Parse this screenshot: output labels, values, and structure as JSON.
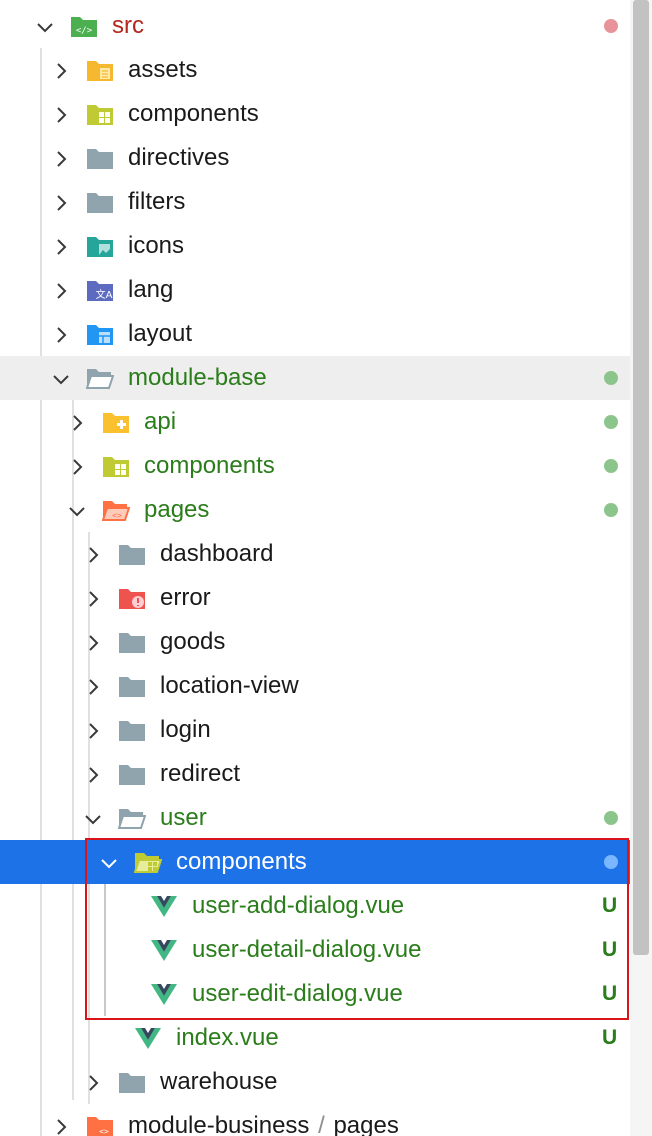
{
  "colors": {
    "modified_dot": "#8cc58c",
    "conflict_dot": "#e8929a",
    "selected_dot": "#7ab7ff",
    "untracked_text": "#2a7d1a",
    "selection_bg": "#1d72e8",
    "highlight_border": "#d9151a"
  },
  "tree": {
    "src": {
      "label": "src",
      "icon": "src-folder-icon",
      "state": "expanded"
    },
    "assets": {
      "label": "assets",
      "icon": "assets-folder-icon",
      "state": "collapsed"
    },
    "components": {
      "label": "components",
      "icon": "components-folder-icon",
      "state": "collapsed"
    },
    "directives": {
      "label": "directives",
      "icon": "folder-icon",
      "state": "collapsed"
    },
    "filters": {
      "label": "filters",
      "icon": "folder-icon",
      "state": "collapsed"
    },
    "icons": {
      "label": "icons",
      "icon": "images-folder-icon",
      "state": "collapsed"
    },
    "lang": {
      "label": "lang",
      "icon": "i18n-folder-icon",
      "state": "collapsed"
    },
    "layout": {
      "label": "layout",
      "icon": "layout-folder-icon",
      "state": "collapsed"
    },
    "module_base": {
      "label": "module-base",
      "icon": "open-folder-icon",
      "state": "expanded"
    },
    "api": {
      "label": "api",
      "icon": "api-folder-icon",
      "state": "collapsed"
    },
    "mb_components": {
      "label": "components",
      "icon": "components-folder-icon",
      "state": "collapsed"
    },
    "pages": {
      "label": "pages",
      "icon": "pages-folder-icon",
      "state": "expanded"
    },
    "dashboard": {
      "label": "dashboard",
      "icon": "folder-icon",
      "state": "collapsed"
    },
    "error": {
      "label": "error",
      "icon": "error-folder-icon",
      "state": "collapsed"
    },
    "goods": {
      "label": "goods",
      "icon": "folder-icon",
      "state": "collapsed"
    },
    "location_view": {
      "label": "location-view",
      "icon": "folder-icon",
      "state": "collapsed"
    },
    "login": {
      "label": "login",
      "icon": "folder-icon",
      "state": "collapsed"
    },
    "redirect": {
      "label": "redirect",
      "icon": "folder-icon",
      "state": "collapsed"
    },
    "user": {
      "label": "user",
      "icon": "open-folder-icon",
      "state": "expanded"
    },
    "user_components": {
      "label": "components",
      "icon": "components-folder-icon",
      "state": "expanded"
    },
    "user_add_dialog": {
      "label": "user-add-dialog.vue",
      "icon": "vue-file-icon",
      "badge": "U"
    },
    "user_detail_dialog": {
      "label": "user-detail-dialog.vue",
      "icon": "vue-file-icon",
      "badge": "U"
    },
    "user_edit_dialog": {
      "label": "user-edit-dialog.vue",
      "icon": "vue-file-icon",
      "badge": "U"
    },
    "index_vue": {
      "label": "index.vue",
      "icon": "vue-file-icon",
      "badge": "U"
    },
    "warehouse": {
      "label": "warehouse",
      "icon": "folder-icon",
      "state": "collapsed"
    },
    "module_business": {
      "label": "module-business",
      "separator": "/",
      "child": "pages",
      "icon": "pages-folder-icon",
      "state": "collapsed"
    }
  }
}
